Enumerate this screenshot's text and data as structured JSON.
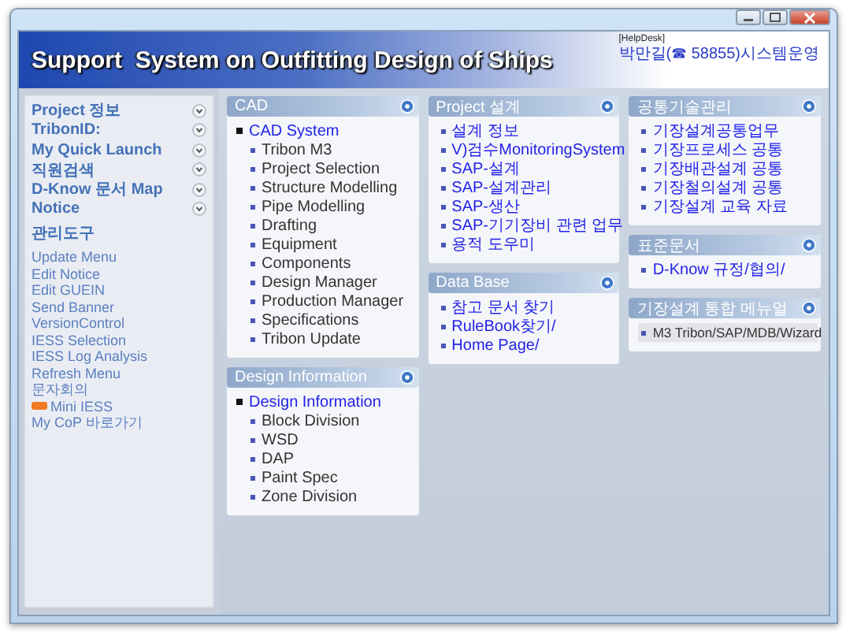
{
  "header": {
    "title": "Support  System on Outfitting Design of Ships",
    "helpdesk_label": "[HelpDesk]",
    "helpdesk_contact": "박만길(☎ 58855)시스템운영"
  },
  "sidebar": {
    "menus": [
      {
        "label": "Project 정보"
      },
      {
        "label": "TribonID:"
      },
      {
        "label": "My Quick Launch"
      },
      {
        "label": "직원검색"
      },
      {
        "label": "D-Know 문서 Map"
      },
      {
        "label": "Notice"
      }
    ],
    "tools_heading": "관리도구",
    "links": [
      {
        "label": "Update Menu",
        "new": false
      },
      {
        "label": "Edit Notice",
        "new": false
      },
      {
        "label": "Edit GUEIN",
        "new": false
      },
      {
        "label": "Send Banner",
        "new": false
      },
      {
        "label": "VersionControl",
        "new": false
      },
      {
        "label": "IESS Selection",
        "new": false
      },
      {
        "label": "IESS Log Analysis",
        "new": false
      },
      {
        "label": "Refresh Menu",
        "new": false
      },
      {
        "label": "문자회의",
        "new": false
      },
      {
        "label": "Mini IESS",
        "new": true
      },
      {
        "label": "My CoP 바로가기",
        "new": false
      }
    ]
  },
  "columns": [
    [
      {
        "title": "CAD",
        "items": [
          {
            "label": "CAD System",
            "children": [
              {
                "label": "Tribon M3"
              },
              {
                "label": "Project Selection"
              },
              {
                "label": "Structure Modelling"
              },
              {
                "label": "Pipe Modelling"
              },
              {
                "label": "Drafting"
              },
              {
                "label": "Equipment"
              },
              {
                "label": "Components"
              },
              {
                "label": "Design Manager"
              },
              {
                "label": "Production Manager"
              },
              {
                "label": "Specifications"
              },
              {
                "label": "Tribon Update"
              }
            ]
          }
        ]
      },
      {
        "title": "Design Information",
        "items": [
          {
            "label": "Design Information",
            "children": [
              {
                "label": "Block Division"
              },
              {
                "label": "WSD"
              },
              {
                "label": "DAP"
              },
              {
                "label": "Paint Spec"
              },
              {
                "label": "Zone Division"
              }
            ]
          }
        ]
      }
    ],
    [
      {
        "title": "Project 설계",
        "items": [
          {
            "label": "설계 정보"
          },
          {
            "label": "V)검수MonitoringSystem"
          },
          {
            "label": "SAP-설계"
          },
          {
            "label": "SAP-설계관리"
          },
          {
            "label": "SAP-생산"
          },
          {
            "label": "SAP-기기장비 관련 업무"
          },
          {
            "label": "용적 도우미"
          }
        ]
      },
      {
        "title": "Data Base",
        "items": [
          {
            "label": "참고 문서 찾기"
          },
          {
            "label": "RuleBook찾기/"
          },
          {
            "label": "Home Page/"
          }
        ]
      }
    ],
    [
      {
        "title": "공통기술관리",
        "items": [
          {
            "label": "기장설계공통업무"
          },
          {
            "label": "기장프로세스 공통"
          },
          {
            "label": "기장배관설계 공통"
          },
          {
            "label": "기장철의설계 공통"
          },
          {
            "label": "기장설계 교육 자료"
          }
        ]
      },
      {
        "title": "표준문서",
        "items": [
          {
            "label": "D-Know 규정/협의/"
          }
        ]
      },
      {
        "title": "기장설계 통합 메뉴얼",
        "items": [
          {
            "label": "M3 Tribon/SAP/MDB/Wizard",
            "selected": true
          }
        ]
      }
    ]
  ]
}
